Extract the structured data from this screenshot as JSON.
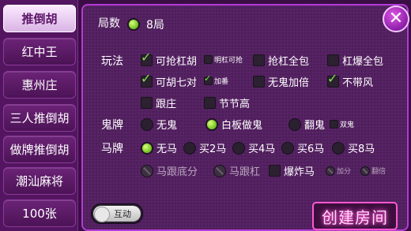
{
  "sidebar": {
    "items": [
      {
        "label": "推倒胡",
        "active": true
      },
      {
        "label": "红中王",
        "active": false
      },
      {
        "label": "惠州庄",
        "active": false
      },
      {
        "label": "三人推倒胡",
        "active": false
      },
      {
        "label": "做牌推倒胡",
        "active": false
      },
      {
        "label": "潮汕麻将",
        "active": false
      },
      {
        "label": "100张",
        "active": false
      }
    ]
  },
  "rounds": {
    "label": "局数",
    "value": "8局"
  },
  "rules": {
    "label": "玩法",
    "options": [
      {
        "text": "可抢杠胡",
        "checked": true
      },
      {
        "text": "明杠可抢",
        "checked": false
      },
      {
        "text": "抢杠全包",
        "checked": false
      },
      {
        "text": "杠爆全包",
        "checked": false
      },
      {
        "text": "可胡七对",
        "checked": true
      },
      {
        "text": "加番",
        "checked": true
      },
      {
        "text": "无鬼加倍",
        "checked": false
      },
      {
        "text": "不带风",
        "checked": true
      },
      {
        "text": "跟庄",
        "checked": false
      },
      {
        "text": "节节高",
        "checked": false
      }
    ]
  },
  "ghost": {
    "label": "鬼牌",
    "options": [
      {
        "text": "无鬼",
        "selected": false
      },
      {
        "text": "白板做鬼",
        "selected": true
      },
      {
        "text": "翻鬼",
        "selected": false
      },
      {
        "text": "双鬼",
        "checked": false
      }
    ]
  },
  "horse": {
    "label": "马牌",
    "options": [
      {
        "text": "无马",
        "selected": true
      },
      {
        "text": "买2马",
        "selected": false
      },
      {
        "text": "买4马",
        "selected": false
      },
      {
        "text": "买6马",
        "selected": false
      },
      {
        "text": "买8马",
        "selected": false
      }
    ],
    "extra": [
      {
        "text": "马跟底分",
        "disabled": true
      },
      {
        "text": "马跟杠",
        "disabled": true
      },
      {
        "text": "爆炸马",
        "checked": false
      },
      {
        "text": "加分",
        "disabled": true
      },
      {
        "text": "翻倍",
        "disabled": true
      }
    ]
  },
  "toggle": {
    "label": "互动",
    "on": false
  },
  "create_button": {
    "label": "创建房间"
  },
  "close_icon": "close-icon",
  "colors": {
    "accent": "#b43bd6",
    "check": "#7fe34a",
    "neon": "#ff57d0"
  }
}
